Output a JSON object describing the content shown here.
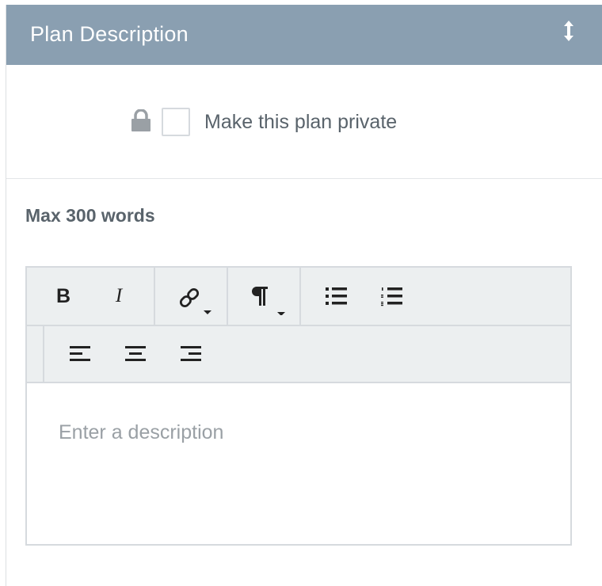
{
  "header": {
    "title": "Plan Description",
    "resize_icon": "vertical-resize-icon"
  },
  "privacy": {
    "lock_icon": "lock-icon",
    "label": "Make this plan private",
    "checked": false
  },
  "description": {
    "max_label": "Max 300 words",
    "placeholder": "Enter a description"
  },
  "toolbar": {
    "bold_label": "B",
    "italic_label": "I",
    "link_icon": "link-icon",
    "paragraph_icon": "paragraph-icon",
    "bullet_list_icon": "bullet-list-icon",
    "numbered_list_icon": "numbered-list-icon",
    "align_left_icon": "align-left-icon",
    "align_center_icon": "align-center-icon",
    "align_right_icon": "align-right-icon"
  },
  "colors": {
    "header_bg": "#8a9fb1",
    "toolbar_bg": "#eceff0",
    "text": "#59636b",
    "placeholder": "#9aa0a5"
  }
}
